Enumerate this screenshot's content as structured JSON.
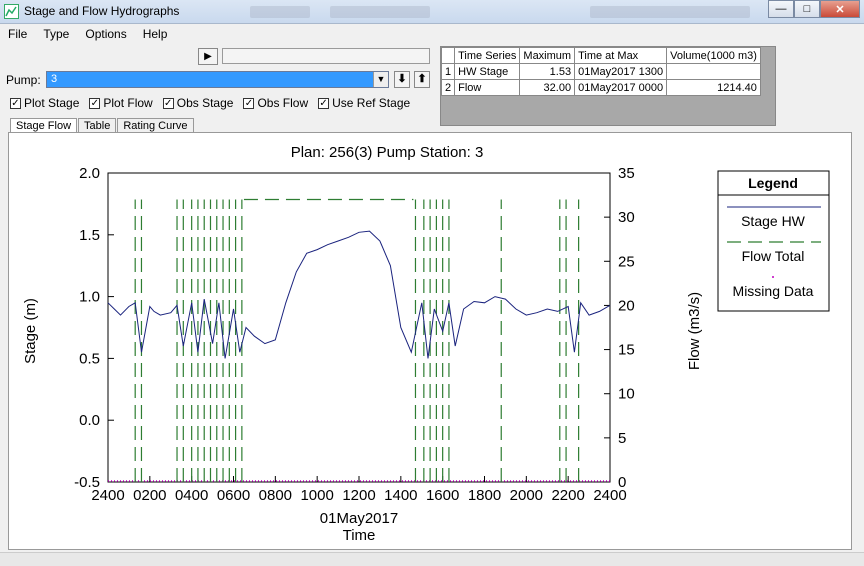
{
  "window": {
    "title": "Stage and Flow Hydrographs"
  },
  "menu": {
    "file": "File",
    "type": "Type",
    "options": "Options",
    "help": "Help"
  },
  "toolbar": {
    "pump_label": "Pump:",
    "pump_value": "3",
    "run_icon": "▶",
    "down_icon": "⬇",
    "up_icon": "⬆"
  },
  "checkboxes": [
    {
      "label": "Plot Stage",
      "checked": true
    },
    {
      "label": "Plot Flow",
      "checked": true
    },
    {
      "label": "Obs Stage",
      "checked": true
    },
    {
      "label": "Obs Flow",
      "checked": true
    },
    {
      "label": "Use Ref Stage",
      "checked": true
    }
  ],
  "tabs": [
    "Stage Flow",
    "Table",
    "Rating Curve"
  ],
  "summary": {
    "headers": [
      "Time Series",
      "Maximum",
      "Time at Max",
      "Volume(1000 m3)"
    ],
    "rows": [
      {
        "idx": "1",
        "series": "HW Stage",
        "max": "1.53",
        "time": "01May2017  1300",
        "volume": ""
      },
      {
        "idx": "2",
        "series": "Flow",
        "max": "32.00",
        "time": "01May2017  0000",
        "volume": "1214.40"
      }
    ]
  },
  "chart_data": {
    "type": "line",
    "title": "Plan: 256(3)    Pump Station: 3",
    "xlabel": "Time",
    "xlabel_date": "01May2017",
    "ylabel_left": "Stage (m)",
    "ylabel_right": "Flow  (m3/s)",
    "x_ticks": [
      "2400",
      "0200",
      "0400",
      "0600",
      "0800",
      "1000",
      "1200",
      "1400",
      "1600",
      "1800",
      "2000",
      "2200",
      "2400"
    ],
    "ylim_left": [
      -0.5,
      2.0
    ],
    "yticks_left": [
      "-0.5",
      "0.0",
      "0.5",
      "1.0",
      "1.5",
      "2.0"
    ],
    "ylim_right": [
      0,
      35
    ],
    "yticks_right": [
      "0",
      "5",
      "10",
      "15",
      "20",
      "25",
      "30",
      "35"
    ],
    "legend": {
      "title": "Legend",
      "items": [
        "Stage HW",
        "Flow Total",
        "Missing Data"
      ],
      "placement": "right"
    },
    "colors": {
      "stage": "#1a237e",
      "flow": "#2e7d32",
      "missing": "#c000c0"
    },
    "series": [
      {
        "name": "Stage HW",
        "axis": "left",
        "x_hours": [
          0,
          0.3,
          0.6,
          1,
          1.3,
          1.6,
          2,
          2.2,
          2.5,
          3,
          3.3,
          3.6,
          4,
          4.3,
          4.6,
          5,
          5.3,
          5.6,
          6,
          6.3,
          6.6,
          7,
          7.5,
          8,
          8.5,
          9,
          9.5,
          10,
          10.5,
          11,
          11.5,
          12,
          12.5,
          13,
          13.5,
          14,
          14.5,
          15,
          15.3,
          15.6,
          16,
          16.3,
          16.6,
          17,
          17.5,
          18,
          18.5,
          19,
          19.5,
          20,
          20.5,
          21,
          21.5,
          22,
          22.3,
          22.6,
          23,
          23.5,
          24
        ],
        "values": [
          0.95,
          0.9,
          0.85,
          0.92,
          0.95,
          0.55,
          0.92,
          0.88,
          0.85,
          0.87,
          0.93,
          0.6,
          0.95,
          0.55,
          0.98,
          0.62,
          0.95,
          0.5,
          0.9,
          0.55,
          0.75,
          0.68,
          0.62,
          0.65,
          0.95,
          1.2,
          1.35,
          1.38,
          1.42,
          1.45,
          1.48,
          1.52,
          1.53,
          1.45,
          1.25,
          0.75,
          0.55,
          0.95,
          0.5,
          0.9,
          0.72,
          0.95,
          0.6,
          0.9,
          0.96,
          0.95,
          1.0,
          0.98,
          0.9,
          0.85,
          0.87,
          0.9,
          0.88,
          0.92,
          0.55,
          0.95,
          0.85,
          0.88,
          0.93
        ]
      },
      {
        "name": "Flow Total",
        "axis": "right",
        "spikes_hours": [
          1.3,
          1.6,
          3.3,
          3.6,
          4.0,
          4.3,
          4.6,
          4.9,
          5.2,
          5.5,
          5.8,
          6.1,
          6.4,
          14.7,
          15.1,
          15.4,
          15.7,
          16.0,
          16.3,
          18.8,
          21.6,
          21.9,
          22.5
        ],
        "plateau_hours": [
          6.5,
          14.6
        ],
        "spike_value": 32.0
      }
    ]
  }
}
